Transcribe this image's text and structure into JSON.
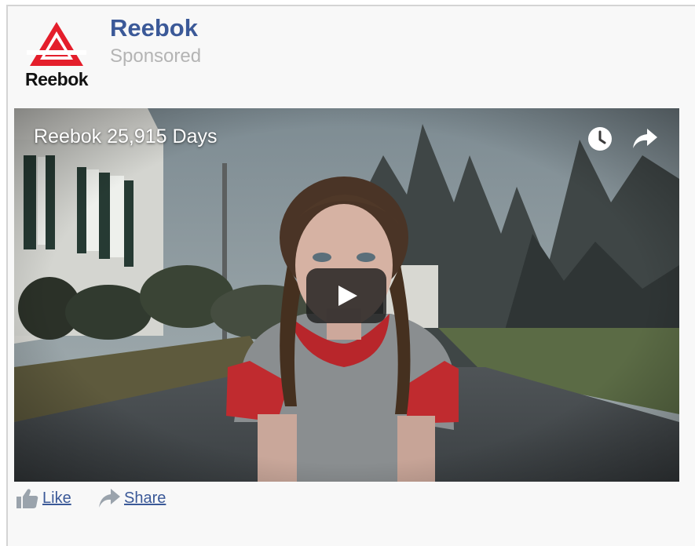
{
  "post": {
    "brand_name": "Reebok",
    "sponsored_label": "Sponsored",
    "logo_text": "Reebok"
  },
  "video": {
    "title": "Reebok 25,915 Days",
    "watch_later_icon": "clock-icon",
    "share_icon": "share-arrow-icon",
    "play_icon": "play-icon"
  },
  "actions": {
    "like_label": "Like",
    "share_label": "Share",
    "like_icon": "thumbs-up-icon",
    "share_icon": "share-arrow-icon"
  },
  "colors": {
    "brand_blue": "#3b5998",
    "logo_red": "#e41e2b",
    "sponsored_gray": "#b4b4b4",
    "card_background": "#f8f8f8"
  }
}
